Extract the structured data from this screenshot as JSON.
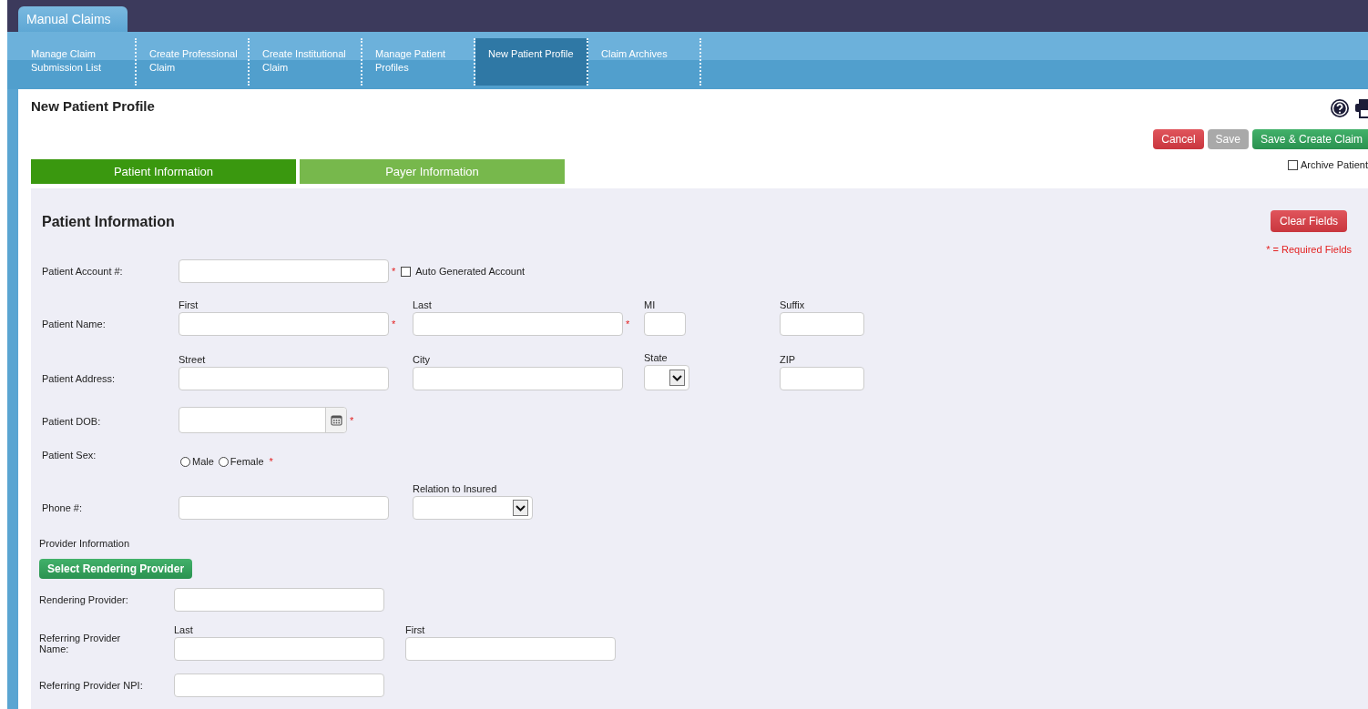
{
  "app_tab": "Manual Claims",
  "nav": [
    {
      "label": "Manage Claim Submission List",
      "selected": false
    },
    {
      "label": "Create Professional Claim",
      "selected": false
    },
    {
      "label": "Create Institutional Claim",
      "selected": false
    },
    {
      "label": "Manage Patient Profiles",
      "selected": false
    },
    {
      "label": "New Patient Profile",
      "selected": true
    },
    {
      "label": "Claim Archives",
      "selected": false
    }
  ],
  "page_title": "New Patient Profile",
  "actions": [
    {
      "label": "Cancel",
      "kind": "danger"
    },
    {
      "label": "Save",
      "kind": "disabled"
    },
    {
      "label": "Save & Create Claim",
      "kind": "primary"
    }
  ],
  "archive": {
    "label": "Archive Patient",
    "checked": false
  },
  "section_tabs": [
    {
      "label": "Patient Information",
      "selected": true
    },
    {
      "label": "Payer Information",
      "selected": false
    }
  ],
  "section": {
    "title": "Patient Information",
    "clear_button": "Clear Fields",
    "required_note": "* = Required Fields"
  },
  "rows": [
    {
      "label": "Patient Account #:",
      "fields": [
        {
          "kind": "text",
          "marker": "*",
          "checkbox": {
            "label": "Auto Generated Account",
            "checked": false
          }
        }
      ]
    },
    {
      "label": "Patient Name:",
      "fields": [
        {
          "kind": "text",
          "caption": "First",
          "marker": "*"
        },
        {
          "kind": "text",
          "caption": "Last",
          "marker": "*"
        },
        {
          "kind": "small",
          "caption": "MI"
        },
        {
          "kind": "medium",
          "caption": "Suffix"
        }
      ]
    },
    {
      "label": "Patient Address:",
      "fields": [
        {
          "kind": "text",
          "caption": "Street"
        },
        {
          "kind": "text",
          "caption": "City"
        },
        {
          "kind": "select-small",
          "caption": "State"
        },
        {
          "kind": "medium",
          "caption": "ZIP"
        }
      ]
    },
    {
      "label": "Patient DOB:",
      "fields": [
        {
          "kind": "date",
          "marker": "*"
        }
      ]
    },
    {
      "label": "Patient Sex:",
      "fields": [
        {
          "kind": "radios",
          "marker": "*",
          "options": [
            {
              "label": "Male",
              "selected": false
            },
            {
              "label": "Female",
              "selected": false
            }
          ]
        }
      ]
    },
    {
      "label": "Phone #:",
      "fields": [
        {
          "kind": "text"
        },
        {
          "kind": "select",
          "caption": "Relation to Insured"
        }
      ]
    }
  ],
  "provider": {
    "heading": "Provider Information",
    "button": "Select Rendering Provider",
    "rows": [
      {
        "label": "Rendering Provider:",
        "fields": [
          {
            "kind": "text"
          }
        ]
      },
      {
        "label": "Referring Provider Name:",
        "fields": [
          {
            "kind": "text",
            "caption": "Last"
          },
          {
            "kind": "text",
            "caption": "First"
          }
        ]
      },
      {
        "label": "Referring Provider NPI:",
        "fields": [
          {
            "kind": "text"
          }
        ]
      }
    ]
  }
}
